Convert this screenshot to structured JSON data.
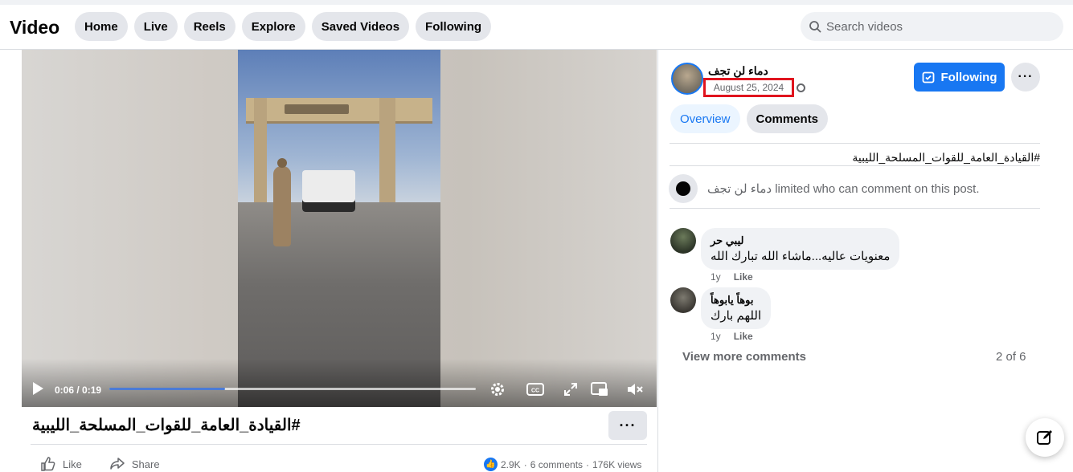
{
  "header": {
    "title": "Video",
    "nav": [
      "Home",
      "Live",
      "Reels",
      "Explore",
      "Saved Videos",
      "Following"
    ],
    "search_placeholder": "Search videos"
  },
  "player": {
    "time": "0:06 / 0:19",
    "progress_fraction": 0.316,
    "accent": "#4b7bd6"
  },
  "post": {
    "title": "#القيادة_العامة_للقوات_المسلحة_الليبية",
    "actions": {
      "like": "Like",
      "share": "Share"
    },
    "stats": {
      "reactions": "2.9K",
      "comments": "6 comments",
      "views": "176K views",
      "separator": "·"
    }
  },
  "panel": {
    "author": "دماء لن تجف",
    "date": "August 25, 2024",
    "follow_label": "Following",
    "tabs": [
      "Overview",
      "Comments"
    ],
    "hashtag": "#القيادة_العامة_للقوات_المسلحة_الليبية",
    "limited_notice": "دماء لن تجف limited who can comment on this post.",
    "comments": [
      {
        "name": "ليبي حر",
        "text": "معنويات عاليه...ماشاء الله تبارك الله",
        "age": "1y",
        "like": "Like"
      },
      {
        "name": "بوهاً يابوهاً",
        "text": "اللهم بارك",
        "age": "1y",
        "like": "Like"
      }
    ],
    "view_more": "View more comments",
    "counter": "2 of 6"
  },
  "colors": {
    "brand_blue": "#1877f2",
    "highlight_red": "#e0141e",
    "chip_gray": "#e4e6eb"
  },
  "icons": [
    "search-icon",
    "play-icon",
    "settings-icon",
    "captions-icon",
    "fullscreen-icon",
    "miniplayer-icon",
    "mute-icon",
    "like-icon",
    "share-icon",
    "globe-icon",
    "following-check-icon",
    "more-icon",
    "compose-icon"
  ]
}
